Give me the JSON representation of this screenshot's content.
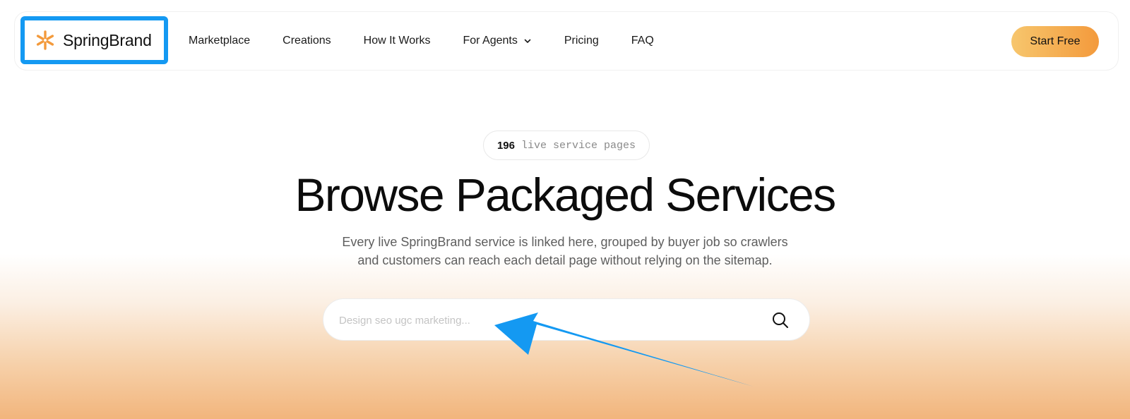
{
  "brand": {
    "name": "SpringBrand",
    "logo_icon": "asterisk-burst-icon",
    "logo_color": "#f39a3c",
    "highlight_color": "#1499f2"
  },
  "nav": {
    "items": [
      {
        "label": "Marketplace"
      },
      {
        "label": "Creations"
      },
      {
        "label": "How It Works"
      },
      {
        "label": "For Agents",
        "icon": "chevron-down-icon"
      },
      {
        "label": "Pricing"
      },
      {
        "label": "FAQ"
      }
    ],
    "cta_label": "Start Free",
    "cta_colors": [
      "#f7c66d",
      "#f39a3c"
    ]
  },
  "hero": {
    "badge_count": "196",
    "badge_label": "live service pages",
    "title": "Browse Packaged Services",
    "subtitle_lines": [
      "Every live SpringBrand service is linked here, grouped by buyer job so crawlers",
      "and customers can reach each detail page without relying on the sitemap."
    ]
  },
  "search": {
    "value": "",
    "placeholder": "Design seo ugc marketing...",
    "icon": "search-icon"
  },
  "annotation": {
    "type": "arrow",
    "color": "#1499f2",
    "points_to": "search-input"
  }
}
